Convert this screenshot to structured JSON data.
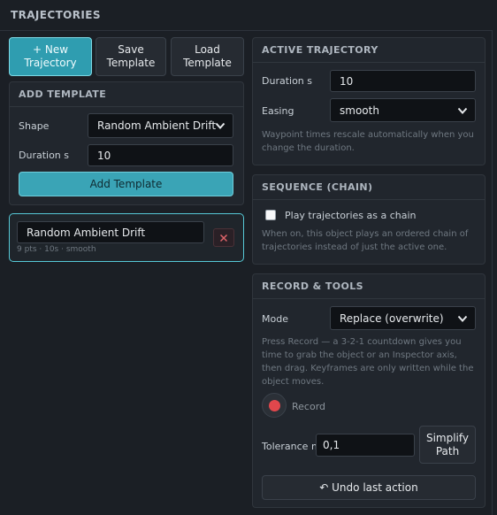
{
  "window": {
    "title": "TRAJECTORIES"
  },
  "toolbar": {
    "new_trajectory": "+ New\nTrajectory",
    "new_trajectory_line1": "+ New",
    "new_trajectory_line2": "Trajectory",
    "save_template_line1": "Save",
    "save_template_line2": "Template",
    "load_template_line1": "Load",
    "load_template_line2": "Template"
  },
  "add_template": {
    "header": "ADD TEMPLATE",
    "shape_label": "Shape",
    "shape_value": "Random Ambient Drift",
    "duration_label": "Duration s",
    "duration_value": "10",
    "add_button": "Add Template"
  },
  "trajectory_list": [
    {
      "name": "Random Ambient Drift",
      "meta": "9 pts · 10s · smooth"
    }
  ],
  "active_trajectory": {
    "header": "ACTIVE TRAJECTORY",
    "duration_label": "Duration s",
    "duration_value": "10",
    "easing_label": "Easing",
    "easing_value": "smooth",
    "hint": "Waypoint times rescale automatically when you change the duration."
  },
  "sequence": {
    "header": "SEQUENCE (CHAIN)",
    "checkbox_label": "Play trajectories as a chain",
    "checked": false,
    "hint": "When on, this object plays an ordered chain of trajectories instead of just the active one."
  },
  "record_tools": {
    "header": "RECORD & TOOLS",
    "mode_label": "Mode",
    "mode_value": "Replace (overwrite)",
    "hint": "Press Record — a 3-2-1 countdown gives you time to grab the object or an Inspector axis, then drag. Keyframes are only written while the object moves.",
    "record_label": "Record",
    "tolerance_label": "Tolerance m",
    "tolerance_value": "0,1",
    "simplify_line1": "Simplify",
    "simplify_line2": "Path",
    "undo_label": "↶ Undo last action"
  },
  "colors": {
    "accent": "#2f9db0",
    "record": "#e0474c",
    "background": "#1b1f25",
    "panel": "#21262d"
  }
}
